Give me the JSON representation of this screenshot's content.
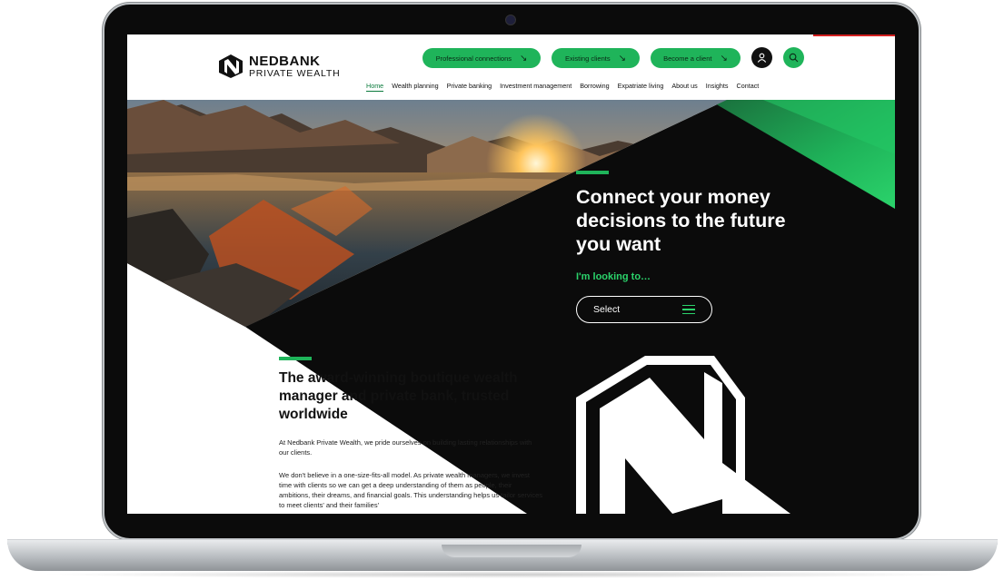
{
  "colors": {
    "brand_green": "#1fb45a",
    "bright_green": "#2bd36b",
    "dark": "#0b0b0b"
  },
  "brand": {
    "name": "NEDBANK",
    "sub": "PRIVATE WEALTH"
  },
  "header": {
    "cta_buttons": [
      {
        "label": "Professional connections",
        "icon": "arrow-down-right-icon"
      },
      {
        "label": "Existing clients",
        "icon": "arrow-down-right-icon"
      },
      {
        "label": "Become a client",
        "icon": "arrow-down-right-icon"
      }
    ],
    "icons": {
      "user": "user-icon",
      "search": "search-icon"
    }
  },
  "nav": {
    "items": [
      "Home",
      "Wealth planning",
      "Private banking",
      "Investment management",
      "Borrowing",
      "Expatriate living",
      "About us",
      "Insights",
      "Contact"
    ]
  },
  "hero": {
    "title": "Connect your money decisions to the future you want",
    "looking_label": "I'm looking to…",
    "select_label": "Select"
  },
  "intro": {
    "title": "The award-winning boutique wealth manager and private bank, trusted worldwide",
    "p1": "At Nedbank Private Wealth, we pride ourselves on building lasting relationships with our clients.",
    "p2": "We don't believe in a one-size-fits-all model. As private wealth managers, we invest time with clients so we can get a deep understanding of them as people, their ambitions, their dreams, and financial goals. This understanding helps us tailor services to meet clients' and their families'"
  }
}
